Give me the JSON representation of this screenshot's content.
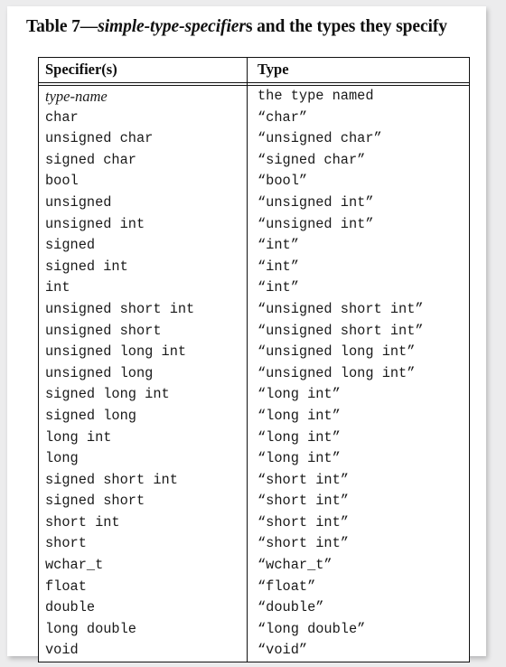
{
  "title": {
    "prefix": "Table 7—",
    "italic": "simple-type-specifier",
    "suffix": "s and the types they specify",
    "full": "Table 7—simple-type-specifiers and the types they specify"
  },
  "table": {
    "headers": [
      "Specifier(s)",
      "Type"
    ],
    "rows": [
      {
        "specifier": "type-name",
        "type": "the type named",
        "specifier_style": "italic-serif"
      },
      {
        "specifier": "char",
        "type": "“char”"
      },
      {
        "specifier": "unsigned char",
        "type": "“unsigned char”"
      },
      {
        "specifier": "signed char",
        "type": "“signed char”"
      },
      {
        "specifier": "bool",
        "type": "“bool”"
      },
      {
        "specifier": "unsigned",
        "type": "“unsigned int”"
      },
      {
        "specifier": "unsigned int",
        "type": "“unsigned int”"
      },
      {
        "specifier": "signed",
        "type": "“int”"
      },
      {
        "specifier": "signed int",
        "type": "“int”"
      },
      {
        "specifier": "int",
        "type": "“int”"
      },
      {
        "specifier": "unsigned short int",
        "type": "“unsigned short int”"
      },
      {
        "specifier": "unsigned short",
        "type": "“unsigned short int”"
      },
      {
        "specifier": "unsigned long int",
        "type": "“unsigned long int”"
      },
      {
        "specifier": "unsigned long",
        "type": "“unsigned long int”"
      },
      {
        "specifier": "signed long int",
        "type": "“long int”"
      },
      {
        "specifier": "signed long",
        "type": "“long int”"
      },
      {
        "specifier": "long int",
        "type": "“long int”"
      },
      {
        "specifier": "long",
        "type": "“long int”"
      },
      {
        "specifier": "signed short int",
        "type": "“short int”"
      },
      {
        "specifier": "signed short",
        "type": "“short int”"
      },
      {
        "specifier": "short int",
        "type": "“short int”"
      },
      {
        "specifier": "short",
        "type": "“short int”"
      },
      {
        "specifier": "wchar_t",
        "type": "“wchar_t”"
      },
      {
        "specifier": "float",
        "type": "“float”"
      },
      {
        "specifier": "double",
        "type": "“double”"
      },
      {
        "specifier": "long double",
        "type": "“long double”"
      },
      {
        "specifier": "void",
        "type": "“void”"
      }
    ]
  },
  "colors": {
    "page_background": "#ffffff",
    "canvas_background": "#ececed",
    "rule": "#111111",
    "text": "#1a1a1a"
  }
}
